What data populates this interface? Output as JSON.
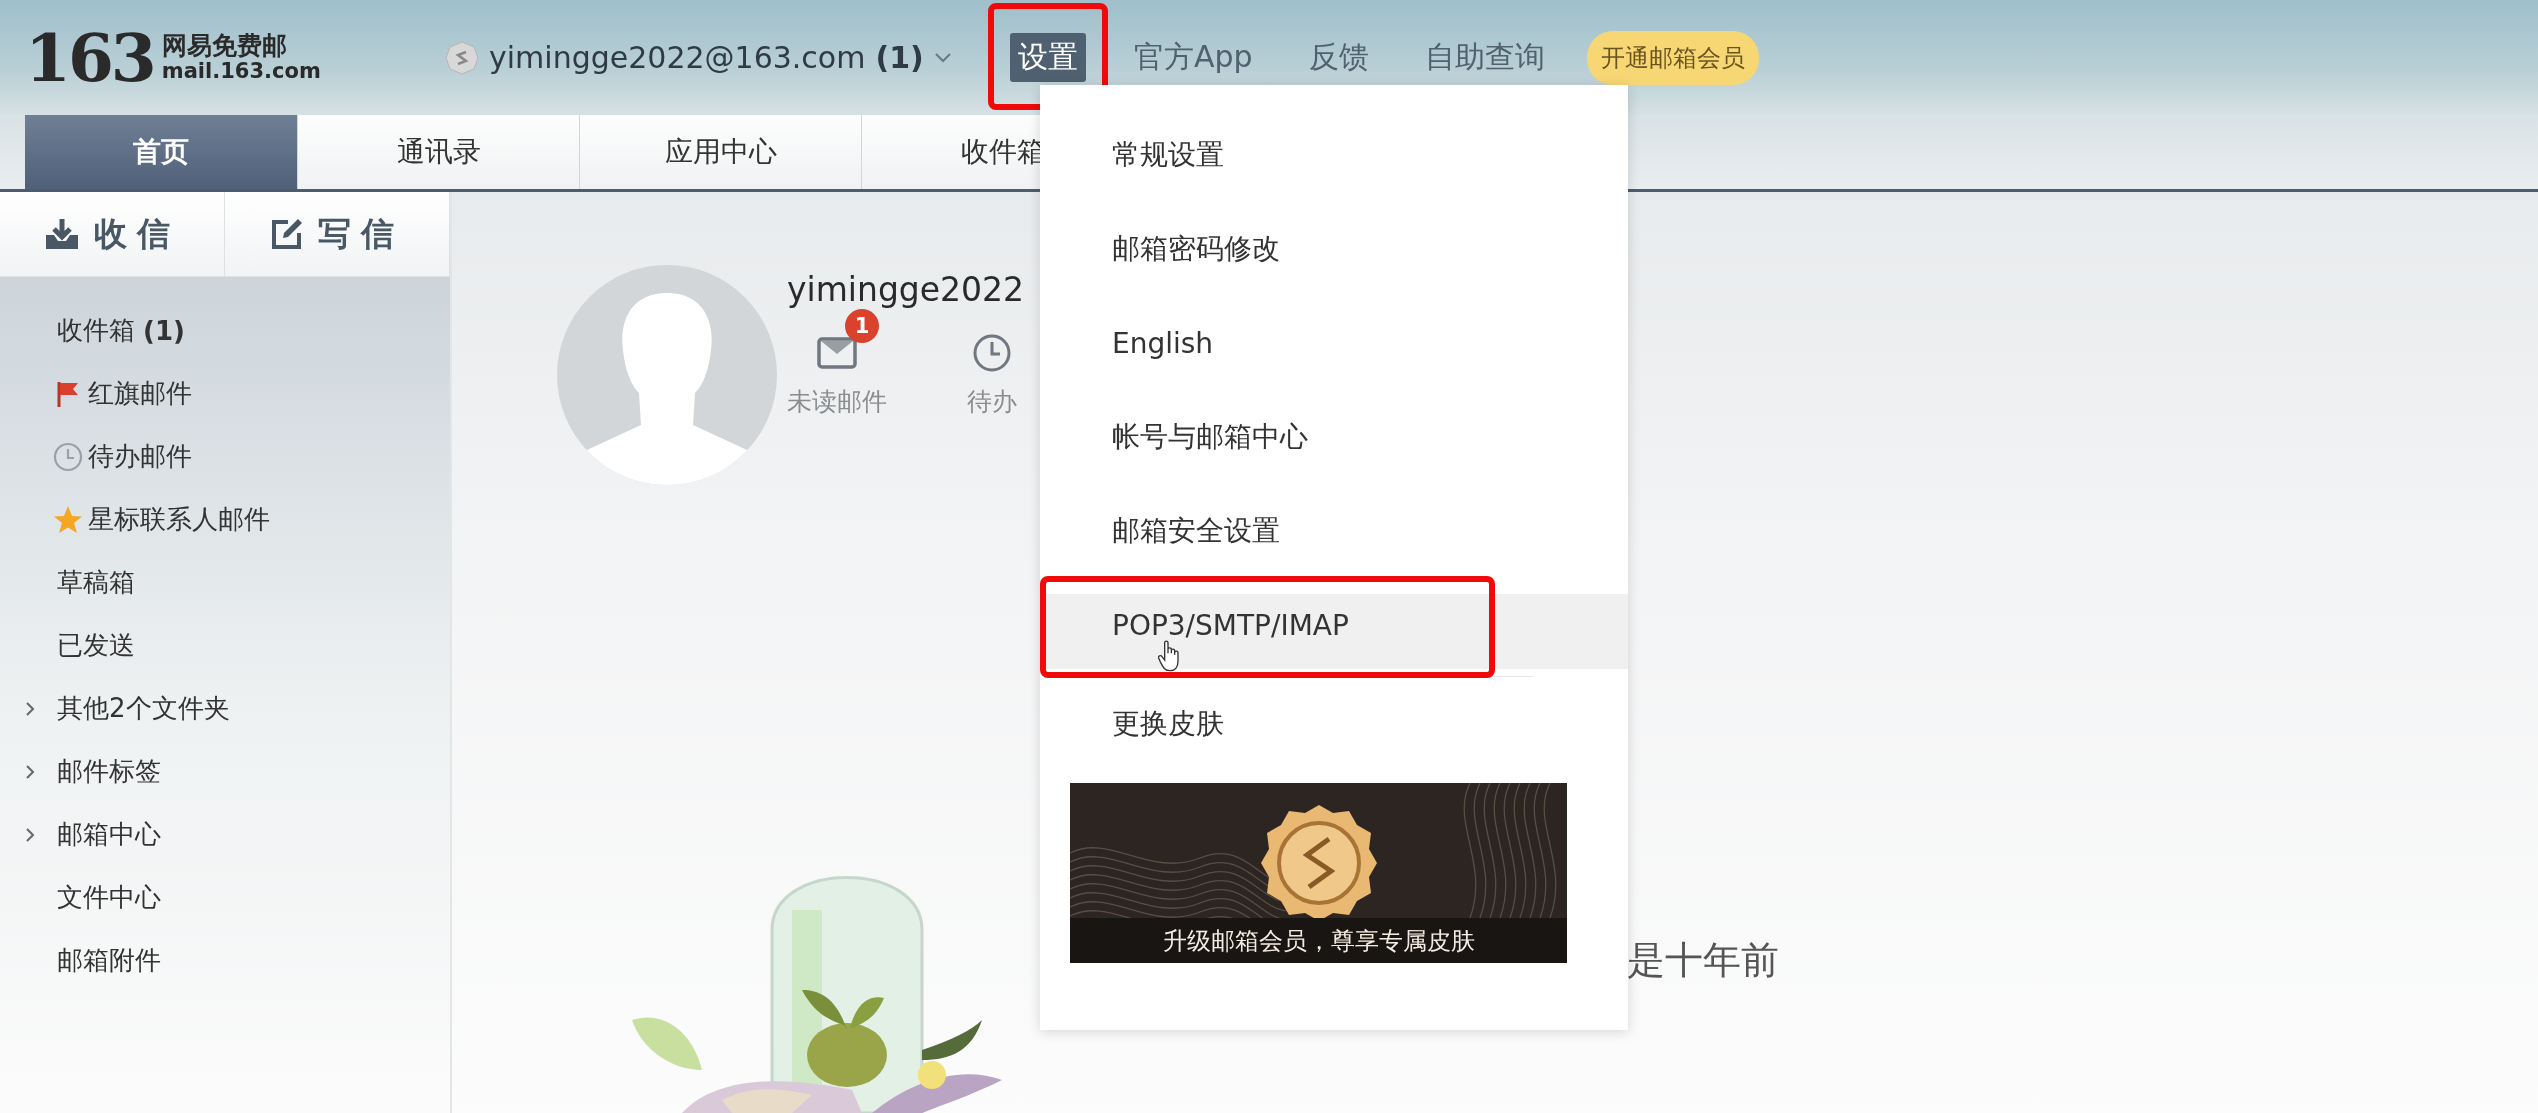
{
  "logo": {
    "number": "163",
    "name": "网易免费邮",
    "domain": "mail.163.com"
  },
  "account": {
    "address": "yimingge2022@163.com",
    "count": "(1)"
  },
  "top_nav": [
    {
      "label": "设置",
      "selected": true,
      "highlighted": true
    },
    {
      "label": "官方App",
      "selected": false,
      "highlighted": false
    },
    {
      "label": "反馈",
      "selected": false,
      "highlighted": false
    },
    {
      "label": "自助查询",
      "selected": false,
      "highlighted": false
    }
  ],
  "vip_button": "开通邮箱会员",
  "tabs": [
    {
      "label": "首页",
      "selected": true
    },
    {
      "label": "通讯录",
      "selected": false
    },
    {
      "label": "应用中心",
      "selected": false
    },
    {
      "label": "收件箱",
      "selected": false
    }
  ],
  "actions": [
    {
      "label": "收信",
      "kind": "receive"
    },
    {
      "label": "写信",
      "kind": "compose"
    }
  ],
  "folders": [
    {
      "label": "收件箱",
      "count": "(1)",
      "kind": "plain"
    },
    {
      "label": "红旗邮件",
      "kind": "flag"
    },
    {
      "label": "待办邮件",
      "kind": "clock"
    },
    {
      "label": "星标联系人邮件",
      "kind": "star"
    },
    {
      "label": "草稿箱",
      "kind": "plain"
    },
    {
      "label": "已发送",
      "kind": "plain"
    },
    {
      "label": "其他2个文件夹",
      "kind": "group",
      "expanded": false
    },
    {
      "label": "邮件标签",
      "kind": "group",
      "expanded": false
    },
    {
      "label": "邮箱中心",
      "kind": "group",
      "expanded": false
    },
    {
      "label": "文件中心",
      "kind": "plain"
    },
    {
      "label": "邮箱附件",
      "kind": "plain"
    }
  ],
  "profile": {
    "name": "yimingge2022",
    "stats": [
      {
        "label": "未读邮件",
        "kind": "unread",
        "badge": "1"
      },
      {
        "label": "待办",
        "kind": "todo"
      }
    ]
  },
  "quote": "是十年前",
  "settings_menu": {
    "items": [
      {
        "label": "常规设置",
        "hovered": false,
        "highlighted": false
      },
      {
        "label": "邮箱密码修改",
        "hovered": false,
        "highlighted": false
      },
      {
        "label": "English",
        "hovered": false,
        "highlighted": false
      },
      {
        "label": "帐号与邮箱中心",
        "hovered": false,
        "highlighted": false
      },
      {
        "label": "邮箱安全设置",
        "hovered": false,
        "highlighted": false
      },
      {
        "label": "POP3/SMTP/IMAP",
        "hovered": true,
        "highlighted": true
      }
    ],
    "skin_item": "更换皮肤",
    "promo": "升级邮箱会员，尊享专属皮肤"
  }
}
